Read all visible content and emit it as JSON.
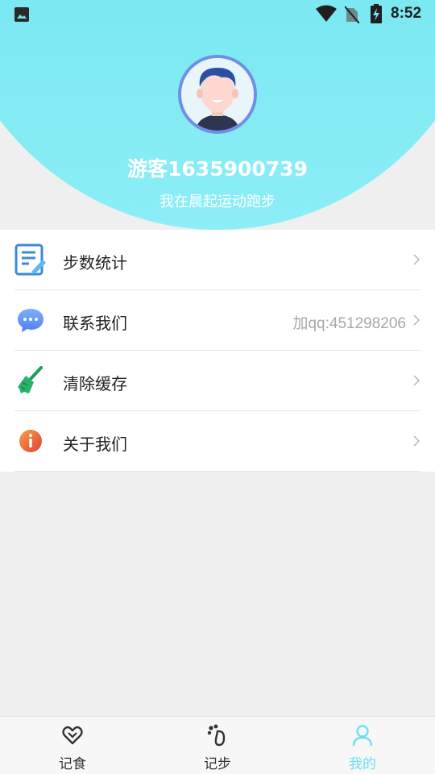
{
  "status_bar": {
    "time": "8:52",
    "left_icon": "image-icon",
    "icons": [
      "wifi-icon",
      "no-sim-icon",
      "battery-charging-icon"
    ]
  },
  "profile": {
    "username": "游客1635900739",
    "motto": "我在晨起运动跑步",
    "avatar": "avatar-boy"
  },
  "menu": [
    {
      "icon": "notepad-icon",
      "label": "步数统计",
      "value": ""
    },
    {
      "icon": "chat-bubble-icon",
      "label": "联系我们",
      "value": "加qq:451298206"
    },
    {
      "icon": "broom-icon",
      "label": "清除缓存",
      "value": ""
    },
    {
      "icon": "info-icon",
      "label": "关于我们",
      "value": ""
    }
  ],
  "tabs": [
    {
      "icon": "heart-icon",
      "label": "记食",
      "active": false
    },
    {
      "icon": "footprint-icon",
      "label": "记步",
      "active": false
    },
    {
      "icon": "person-icon",
      "label": "我的",
      "active": true
    }
  ],
  "colors": {
    "header_gradient_top": "#5fdfeb",
    "header_gradient_bottom": "#8ceef6",
    "accent": "#6de2ee",
    "avatar_ring": "#6f8ee8"
  }
}
